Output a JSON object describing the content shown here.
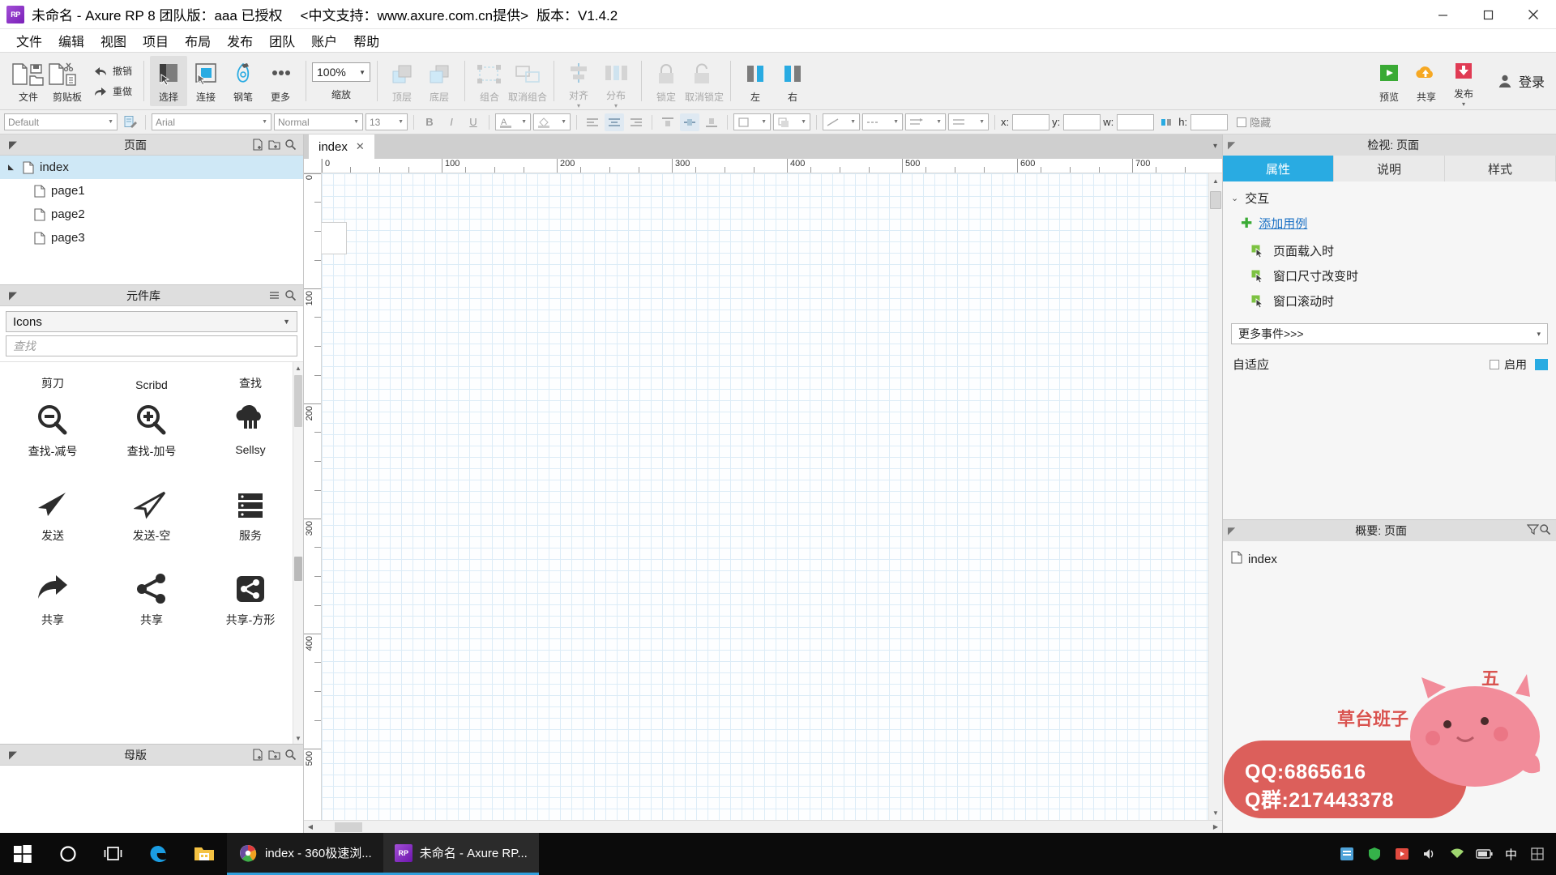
{
  "titlebar": {
    "logo": "RP",
    "title": "未命名 - Axure RP 8 团队版：aaa 已授权",
    "support": "<中文支持：www.axure.com.cn提供>",
    "version": "版本：V1.4.2",
    "minimize": "—",
    "maximize": "❐",
    "close": "✕"
  },
  "menubar": {
    "items": [
      "文件",
      "编辑",
      "视图",
      "项目",
      "布局",
      "发布",
      "团队",
      "账户",
      "帮助"
    ]
  },
  "toolbar": {
    "groups": [
      {
        "buttons": [
          {
            "label": "文件",
            "icon": "file-open-icon"
          },
          {
            "label": "剪贴板",
            "icon": "clipboard-icon"
          },
          {
            "label": "撤销",
            "icon": "undo-icon",
            "sub": "重做"
          }
        ]
      },
      {
        "buttons": [
          {
            "label": "选择",
            "icon": "select-tool-icon",
            "active": true
          },
          {
            "label": "连接",
            "icon": "connect-tool-icon"
          },
          {
            "label": "钢笔",
            "icon": "pen-tool-icon"
          },
          {
            "label": "更多",
            "icon": "more-dots-icon"
          }
        ]
      },
      {
        "buttons": [
          {
            "label": "缩放",
            "icon": "zoom-icon",
            "value": "100%"
          }
        ]
      },
      {
        "buttons": [
          {
            "label": "顶层",
            "icon": "bring-front-icon"
          },
          {
            "label": "底层",
            "icon": "send-back-icon"
          }
        ]
      },
      {
        "buttons": [
          {
            "label": "组合",
            "icon": "group-icon"
          },
          {
            "label": "取消组合",
            "icon": "ungroup-icon"
          }
        ]
      },
      {
        "buttons": [
          {
            "label": "对齐",
            "icon": "align-icon"
          },
          {
            "label": "分布",
            "icon": "distribute-icon"
          }
        ]
      },
      {
        "buttons": [
          {
            "label": "锁定",
            "icon": "lock-icon"
          },
          {
            "label": "取消锁定",
            "icon": "unlock-icon"
          }
        ]
      },
      {
        "buttons": [
          {
            "label": "左",
            "icon": "align-left-icon"
          },
          {
            "label": "右",
            "icon": "align-right-icon"
          }
        ]
      }
    ],
    "right": [
      {
        "label": "预览",
        "icon": "preview-play-icon"
      },
      {
        "label": "共享",
        "icon": "share-cloud-icon"
      },
      {
        "label": "发布",
        "icon": "publish-icon"
      }
    ],
    "login": "登录",
    "undo_label": "撤销",
    "redo_label": "重做",
    "zoom_value": "100%"
  },
  "formatbar": {
    "style_select": "Default",
    "style_icon": "style-edit-icon",
    "font_select": "Arial",
    "weight_select": "Normal",
    "size_select": "13",
    "bold": "B",
    "italic": "I",
    "underline": "U",
    "text_color_icon": "text-color-icon",
    "fill_icon": "fill-color-icon",
    "align_left": "align-left-icon",
    "align_center": "align-center-icon",
    "align_right": "align-right-icon",
    "valign_top": "valign-top-icon",
    "valign_middle": "valign-middle-icon",
    "valign_bottom": "valign-bottom-icon",
    "border_icon": "border-icon",
    "shadow_icon": "shadow-icon",
    "line_icon": "line-style-icon",
    "arrow_icon": "arrow-style-icon",
    "point_icon": "point-style-icon",
    "x_label": "x:",
    "x_value": "",
    "y_label": "y:",
    "y_value": "",
    "w_label": "w:",
    "w_value": "",
    "h_label": "h:",
    "h_value": "",
    "lock_icon": "ratio-lock-icon",
    "hide_label": "隐藏"
  },
  "pages_panel": {
    "header": "页面",
    "add_page_icon": "add-page-icon",
    "add_folder_icon": "add-folder-icon",
    "search_icon": "search-icon",
    "pin_icon": "pin-icon",
    "tree": [
      {
        "label": "index",
        "level": 0,
        "selected": true,
        "expander": "▲"
      },
      {
        "label": "page1",
        "level": 1,
        "selected": false
      },
      {
        "label": "page2",
        "level": 1,
        "selected": false
      },
      {
        "label": "page3",
        "level": 1,
        "selected": false
      }
    ]
  },
  "library_panel": {
    "header": "元件库",
    "menu_icon": "hamburger-icon",
    "search_icon": "search-icon",
    "library_select": "Icons",
    "search_placeholder": "查找",
    "clipped_row": [
      "剪刀",
      "Scribd",
      "查找"
    ],
    "items": [
      {
        "caption": "查找-减号",
        "icon": "search-minus-icon"
      },
      {
        "caption": "查找-加号",
        "icon": "search-plus-icon"
      },
      {
        "caption": "Sellsy",
        "icon": "sellsy-icon"
      },
      {
        "caption": "发送",
        "icon": "send-filled-icon"
      },
      {
        "caption": "发送-空",
        "icon": "send-outline-icon"
      },
      {
        "caption": "服务",
        "icon": "server-icon"
      },
      {
        "caption": "共享",
        "icon": "share-arrow-icon"
      },
      {
        "caption": "共享",
        "icon": "share-nodes-icon"
      },
      {
        "caption": "共享-方形",
        "icon": "share-square-icon"
      }
    ]
  },
  "masters_panel": {
    "header": "母版",
    "add_icon": "add-master-icon",
    "add_folder_icon": "add-folder-icon",
    "search_icon": "search-icon"
  },
  "canvas": {
    "tab_label": "index",
    "tab_close": "✕",
    "tab_dropdown": "▾",
    "h_ruler_ticks": [
      "0",
      "100",
      "200",
      "300",
      "400",
      "500",
      "600",
      "700"
    ],
    "v_ruler_ticks": [
      "0",
      "100",
      "200",
      "300",
      "400",
      "500"
    ]
  },
  "inspector": {
    "header": "检视: 页面",
    "pin_icon": "pin-icon",
    "tabs": [
      {
        "label": "属性",
        "active": true
      },
      {
        "label": "说明",
        "active": false
      },
      {
        "label": "样式",
        "active": false
      }
    ],
    "section_title": "交互",
    "add_case": "添加用例",
    "events": [
      {
        "label": "页面载入时",
        "icon": "event-cursor-icon"
      },
      {
        "label": "窗口尺寸改变时",
        "icon": "event-cursor-icon"
      },
      {
        "label": "窗口滚动时",
        "icon": "event-cursor-icon"
      }
    ],
    "more_events": "更多事件>>>",
    "more_events_caret": "▾",
    "adaptive_label": "自适应",
    "enable_label": "启用",
    "adaptive_icon": "adaptive-device-icon"
  },
  "outline": {
    "header": "概要: 页面",
    "filter_icon": "filter-icon",
    "search_icon": "search-icon",
    "pin_icon": "pin-icon",
    "rows": [
      {
        "label": "index",
        "icon": "page-icon"
      }
    ]
  },
  "watermark": {
    "brand": "草台班子",
    "five": "五",
    "qq1": "QQ:6865616",
    "qq2": "Q群:217443378"
  },
  "taskbar": {
    "start_icon": "windows-start-icon",
    "cortana_icon": "cortana-circle-icon",
    "taskview_icon": "task-view-icon",
    "pinned": [
      {
        "name": "edge-icon",
        "label": ""
      },
      {
        "name": "file-explorer-icon",
        "label": ""
      }
    ],
    "apps": [
      {
        "label": "index - 360极速浏...",
        "icon": "browser-360-icon",
        "active": false
      },
      {
        "label": "未命名 - Axure RP...",
        "icon": "axure-rp-icon",
        "active": true
      }
    ],
    "tray": [
      {
        "name": "tray-app-icon"
      },
      {
        "name": "tray-shield-icon"
      },
      {
        "name": "tray-media-icon"
      },
      {
        "name": "tray-volume-icon"
      },
      {
        "name": "tray-network-icon"
      },
      {
        "name": "tray-battery-icon"
      }
    ],
    "ime_label": "中",
    "show_desktop_icon": "show-desktop-icon"
  },
  "colors": {
    "accent": "#29ABE2",
    "selection": "#cfe8f6",
    "link": "#1a70c4",
    "green": "#3aaa35",
    "taskbar": "#0b0b0b",
    "grid": "#dcecf7"
  }
}
